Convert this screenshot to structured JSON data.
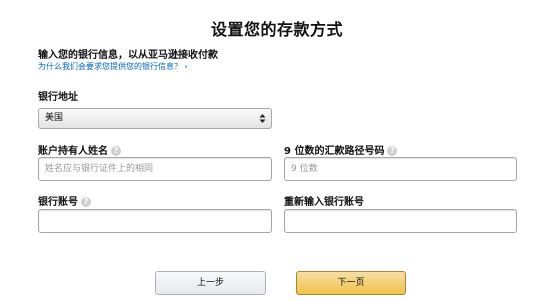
{
  "page": {
    "title": "设置您的存款方式",
    "subtitle": "输入您的银行信息，以从亚马逊接收付款",
    "help_link": "为什么我们会要求您提供您的银行信息？ ›"
  },
  "bank_location": {
    "label": "银行地址",
    "selected": "美国"
  },
  "account_holder": {
    "label": "账户持有人姓名",
    "placeholder": "姓名应与银行证件上的相同"
  },
  "routing_number": {
    "label": "9 位数的汇款路径号码",
    "placeholder": "9 位数"
  },
  "account_number": {
    "label": "银行账号",
    "placeholder": ""
  },
  "reenter_account": {
    "label": "重新输入银行账号",
    "placeholder": ""
  },
  "buttons": {
    "prev": "上一步",
    "next": "下一页"
  },
  "colors": {
    "link": "#0066c0",
    "primary_button": "#f0c14b"
  },
  "icons": {
    "help": "help-question-icon",
    "select_arrows": "select-arrows-icon"
  }
}
